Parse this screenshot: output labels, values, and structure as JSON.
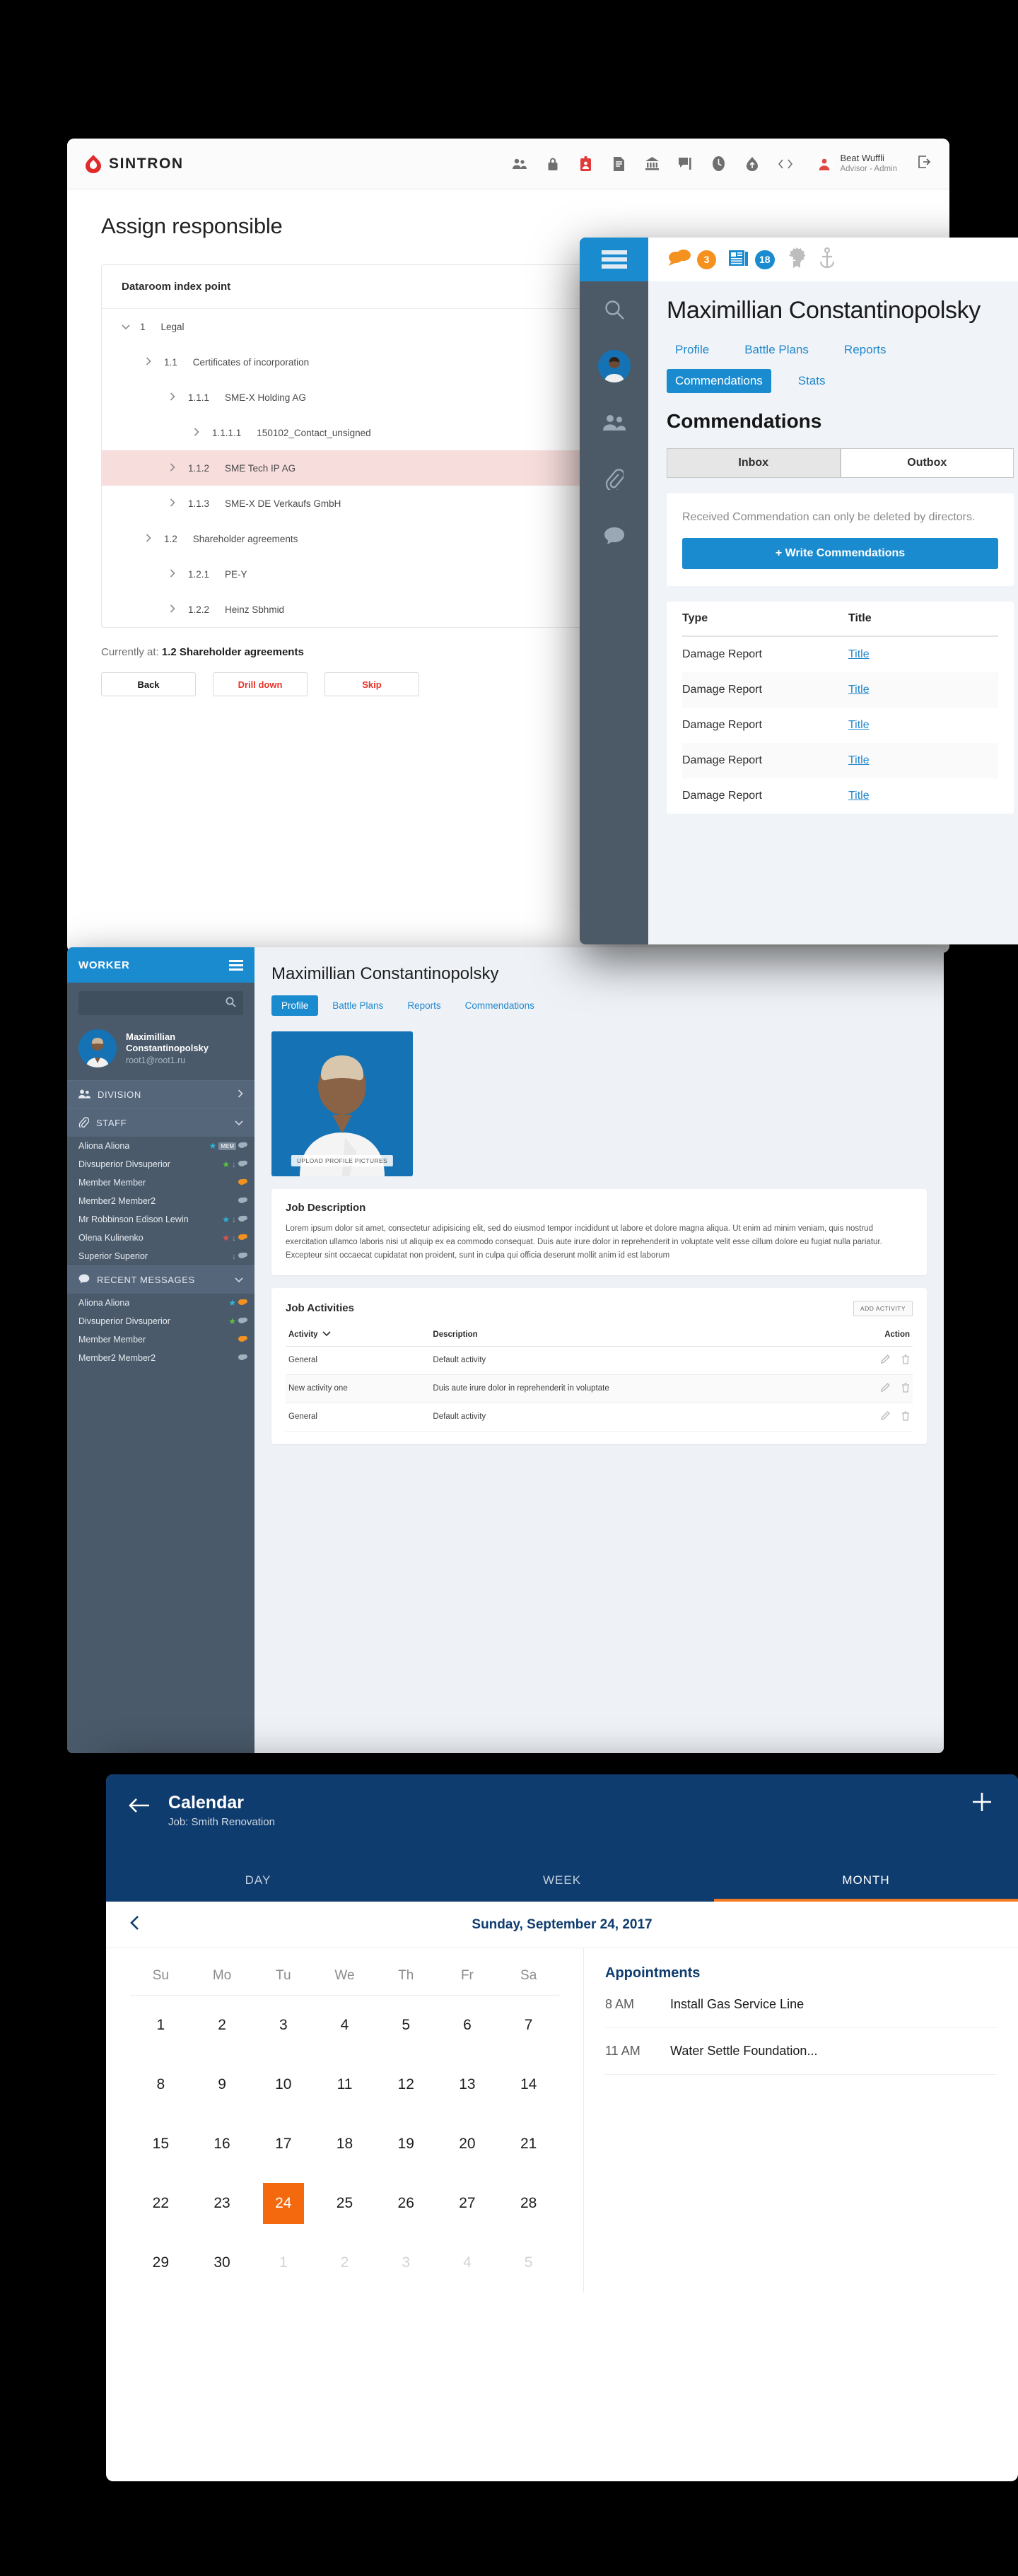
{
  "sintron": {
    "brand": "SINTRON",
    "toolbar_icons": [
      "people-icon",
      "lock-icon",
      "id-badge-icon",
      "document-icon",
      "bank-icon",
      "comment-flag-icon",
      "clock-icon",
      "cloud-upload-icon",
      "code-icon"
    ],
    "user": {
      "name": "Beat Wuffli",
      "role": "Advisor - Admin",
      "avatar_icon": "user-avatar-icon",
      "logout_icon": "logout-icon"
    },
    "page_title": "Assign responsible",
    "card_title": "Dataroom index point",
    "tree": [
      {
        "indent": 0,
        "caret": "down",
        "num": "1",
        "label": "Legal",
        "selected": false
      },
      {
        "indent": 1,
        "caret": "right",
        "num": "1.1",
        "label": "Certificates of incorporation",
        "selected": false
      },
      {
        "indent": 2,
        "caret": "right",
        "num": "1.1.1",
        "label": "SME-X Holding AG",
        "selected": false
      },
      {
        "indent": 3,
        "caret": "right",
        "num": "1.1.1.1",
        "label": "150102_Contact_unsigned",
        "selected": false
      },
      {
        "indent": 2,
        "caret": "right",
        "num": "1.1.2",
        "label": "SME Tech IP AG",
        "selected": true
      },
      {
        "indent": 2,
        "caret": "right",
        "num": "1.1.3",
        "label": "SME-X DE Verkaufs GmbH",
        "selected": false
      },
      {
        "indent": 1,
        "caret": "right",
        "num": "1.2",
        "label": "Shareholder agreements",
        "selected": false
      },
      {
        "indent": 2,
        "caret": "right",
        "num": "1.2.1",
        "label": "PE-Y",
        "selected": false
      },
      {
        "indent": 2,
        "caret": "right",
        "num": "1.2.2",
        "label": "Heinz Sbhmid",
        "selected": false
      }
    ],
    "currently_label": "Currently at:",
    "currently_value": "1.2 Shareholder agreements",
    "buttons": [
      {
        "label": "Back",
        "style": "dark"
      },
      {
        "label": "Drill down",
        "style": "red"
      },
      {
        "label": "Skip",
        "style": "red"
      }
    ],
    "accent_red": "#e8332a"
  },
  "commendations_app": {
    "menu_icon": "hamburger-menu-icon",
    "rail_icons": [
      "search-icon",
      "user-avatar-icon",
      "group-icon",
      "paperclip-icon",
      "chat-icon"
    ],
    "topbar": [
      {
        "icon": "chat-bubbles-icon",
        "count": "3",
        "color": "#f5911e"
      },
      {
        "icon": "newspaper-icon",
        "count": "18",
        "color": "#1b8bd0"
      },
      {
        "icon": "award-ribbon-icon",
        "count": "",
        "color": ""
      },
      {
        "icon": "anchor-icon",
        "count": "",
        "color": ""
      }
    ],
    "person_name": "Maximillian Constantinopolsky",
    "tabs": [
      {
        "label": "Profile",
        "active": false
      },
      {
        "label": "Battle Plans",
        "active": false
      },
      {
        "label": "Reports",
        "active": false
      },
      {
        "label": "Commendations",
        "active": true
      },
      {
        "label": "Stats",
        "active": false
      }
    ],
    "heading": "Commendations",
    "segments": [
      {
        "label": "Inbox",
        "active": true
      },
      {
        "label": "Outbox",
        "active": false
      }
    ],
    "notice": "Received Commendation can only be deleted by directors.",
    "write_button": "+ Write Commendations",
    "table": {
      "headers": [
        "Type",
        "Title"
      ],
      "rows": [
        {
          "type": "Damage Report",
          "title": "Title"
        },
        {
          "type": "Damage Report",
          "title": "Title"
        },
        {
          "type": "Damage Report",
          "title": "Title"
        },
        {
          "type": "Damage Report",
          "title": "Title"
        },
        {
          "type": "Damage Report",
          "title": "Title"
        }
      ]
    },
    "accent_blue": "#1b8bd0"
  },
  "worker_app": {
    "sidebar": {
      "title": "WORKER",
      "menu_icon": "hamburger-menu-icon",
      "search_placeholder": "",
      "search_icon": "search-icon",
      "profile": {
        "name": "Maximillian Constantinopolsky",
        "email": "root1@root1.ru",
        "avatar_icon": "user-avatar-icon"
      },
      "groups": [
        {
          "label": "DIVISION",
          "icon": "group-icon",
          "chevron": "chevron-right-icon",
          "items": []
        },
        {
          "label": "STAFF",
          "icon": "paperclip-icon",
          "chevron": "chevron-down-icon",
          "items": [
            {
              "name": "Aliona Aliona",
              "badges": [
                "★ #29b6d8",
                "MEM",
                "💬"
              ]
            },
            {
              "name": "Divsuperior Divsuperior",
              "badges": [
                "★ #59c63c",
                "↓",
                "💬"
              ]
            },
            {
              "name": "Member Member",
              "badges": [
                "💬"
              ]
            },
            {
              "name": "Member2 Member2",
              "badges": [
                "💬"
              ]
            },
            {
              "name": "Mr Robbinson Edison Lewin",
              "badges": [
                "★ #29b6d8",
                "↓",
                "💬"
              ]
            },
            {
              "name": "Olena Kulinenko",
              "badges": [
                "★ #e0534f",
                "↓",
                "💬"
              ]
            },
            {
              "name": "Superior Superior",
              "badges": [
                "↓",
                "💬"
              ]
            }
          ]
        },
        {
          "label": "RECENT MESSAGES",
          "icon": "chat-icon",
          "chevron": "chevron-down-icon",
          "items": [
            {
              "name": "Aliona Aliona",
              "badges": [
                "★ #29b6d8",
                "💬"
              ]
            },
            {
              "name": "Divsuperior Divsuperior",
              "badges": [
                "★ #59c63c",
                "💬"
              ]
            },
            {
              "name": "Member Member",
              "badges": [
                "💬"
              ]
            },
            {
              "name": "Member2 Member2",
              "badges": [
                "💬"
              ]
            }
          ]
        }
      ]
    },
    "main": {
      "title": "Maximillian Constantinopolsky",
      "tabs": [
        {
          "label": "Profile",
          "active": true
        },
        {
          "label": "Battle Plans",
          "active": false
        },
        {
          "label": "Reports",
          "active": false
        },
        {
          "label": "Commendations",
          "active": false
        }
      ],
      "photo_upload_label": "UPLOAD PROFILE PICTURES",
      "job_description_title": "Job Description",
      "job_description_text": "Lorem ipsum dolor sit amet, consectetur adipisicing elit, sed do eiusmod tempor incididunt ut labore et dolore magna aliqua. Ut enim ad minim veniam, quis nostrud exercitation ullamco laboris nisi ut aliquip ex ea commodo consequat. Duis aute irure dolor in reprehenderit in voluptate velit esse cillum dolore eu fugiat nulla pariatur. Excepteur sint occaecat cupidatat non proident, sunt in culpa qui officia deserunt mollit anim id est laborum",
      "activities_title": "Job Activities",
      "add_activity_label": "ADD ACTIVITY",
      "activities_headers": [
        "Activity",
        "Description",
        "Action"
      ],
      "activities_sort_icon": "chevron-down-icon",
      "activities": [
        {
          "activity": "General",
          "description": "Default activity"
        },
        {
          "activity": "New activity one",
          "description": "Duis aute irure dolor in reprehenderit in voluptate"
        },
        {
          "activity": "General",
          "description": "Default activity"
        }
      ],
      "row_action_icons": [
        "pencil-icon",
        "trash-icon"
      ]
    }
  },
  "calendar_app": {
    "back_icon": "arrow-left-icon",
    "add_icon": "plus-icon",
    "title": "Calendar",
    "subtitle": "Job: Smith Renovation",
    "modes": [
      {
        "label": "DAY",
        "active": false
      },
      {
        "label": "WEEK",
        "active": false
      },
      {
        "label": "MONTH",
        "active": true
      }
    ],
    "prev_icon": "chevron-left-icon",
    "current_date": "Sunday, September 24, 2017",
    "dow": [
      "Su",
      "Mo",
      "Tu",
      "We",
      "Th",
      "Fr",
      "Sa"
    ],
    "weeks": [
      [
        {
          "d": "1"
        },
        {
          "d": "2"
        },
        {
          "d": "3"
        },
        {
          "d": "4"
        },
        {
          "d": "5"
        },
        {
          "d": "6"
        },
        {
          "d": "7"
        }
      ],
      [
        {
          "d": "8"
        },
        {
          "d": "9"
        },
        {
          "d": "10"
        },
        {
          "d": "11"
        },
        {
          "d": "12"
        },
        {
          "d": "13"
        },
        {
          "d": "14"
        }
      ],
      [
        {
          "d": "15"
        },
        {
          "d": "16"
        },
        {
          "d": "17"
        },
        {
          "d": "18"
        },
        {
          "d": "19"
        },
        {
          "d": "20"
        },
        {
          "d": "21"
        }
      ],
      [
        {
          "d": "22"
        },
        {
          "d": "23"
        },
        {
          "d": "24",
          "sel": true
        },
        {
          "d": "25"
        },
        {
          "d": "26"
        },
        {
          "d": "27"
        },
        {
          "d": "28"
        }
      ],
      [
        {
          "d": "29"
        },
        {
          "d": "30"
        },
        {
          "d": "1",
          "mut": true
        },
        {
          "d": "2",
          "mut": true
        },
        {
          "d": "3",
          "mut": true
        },
        {
          "d": "4",
          "mut": true
        },
        {
          "d": "5",
          "mut": true
        }
      ]
    ],
    "appointments_title": "Appointments",
    "appointments": [
      {
        "time": "8 AM",
        "name": "Install Gas Service Line"
      },
      {
        "time": "11 AM",
        "name": "Water Settle Foundation..."
      }
    ],
    "accent_orange": "#f4690d",
    "header_blue": "#0f3c6e"
  }
}
